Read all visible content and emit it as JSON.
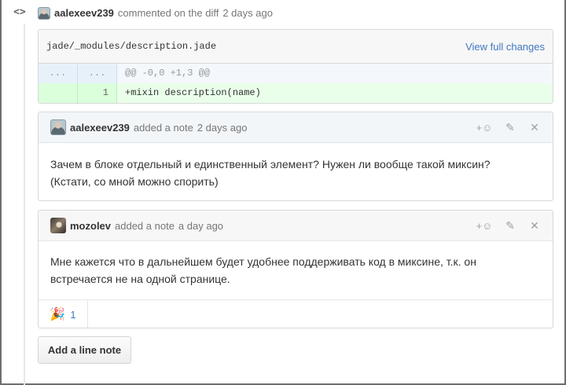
{
  "timeline_event": {
    "author": "aalexeev239",
    "action_text": "commented on the diff",
    "time": "2 days ago"
  },
  "file": {
    "path": "jade/_modules/description.jade",
    "view_link": "View full changes",
    "hunk": {
      "left_num": "...",
      "right_num": "...",
      "text": "@@ -0,0 +1,3 @@"
    },
    "added_line": {
      "left_num": "",
      "right_num": "1",
      "text": "+mixin description(name)"
    }
  },
  "notes": [
    {
      "author": "aalexeev239",
      "action_text": "added a note",
      "time": "2 days ago",
      "body_line1": "Зачем в блоке отдельный и единственный элемент? Нужен ли вообще такой миксин?",
      "body_line2": "(Кстати, со мной можно спорить)",
      "reaction_icon": "+☺",
      "edit_icon": "✎",
      "delete_icon": "✕"
    },
    {
      "author": "mozolev",
      "action_text": "added a note",
      "time": "a day ago",
      "body_line1": "Мне кажется что в дальнейшем будет удобнее поддерживать код в миксине, т.к. он",
      "body_line2": "встречается не на одной странице.",
      "reaction_icon": "+☺",
      "edit_icon": "✎",
      "delete_icon": "✕",
      "reactions": [
        {
          "emoji": "🎉",
          "count": "1"
        }
      ]
    }
  ],
  "add_line_note_label": "Add a line note",
  "timeline_icon": "<>",
  "colors": {
    "link": "#4078c0",
    "added_bg": "#eaffea",
    "hunk_bg": "#f4f7fb"
  }
}
